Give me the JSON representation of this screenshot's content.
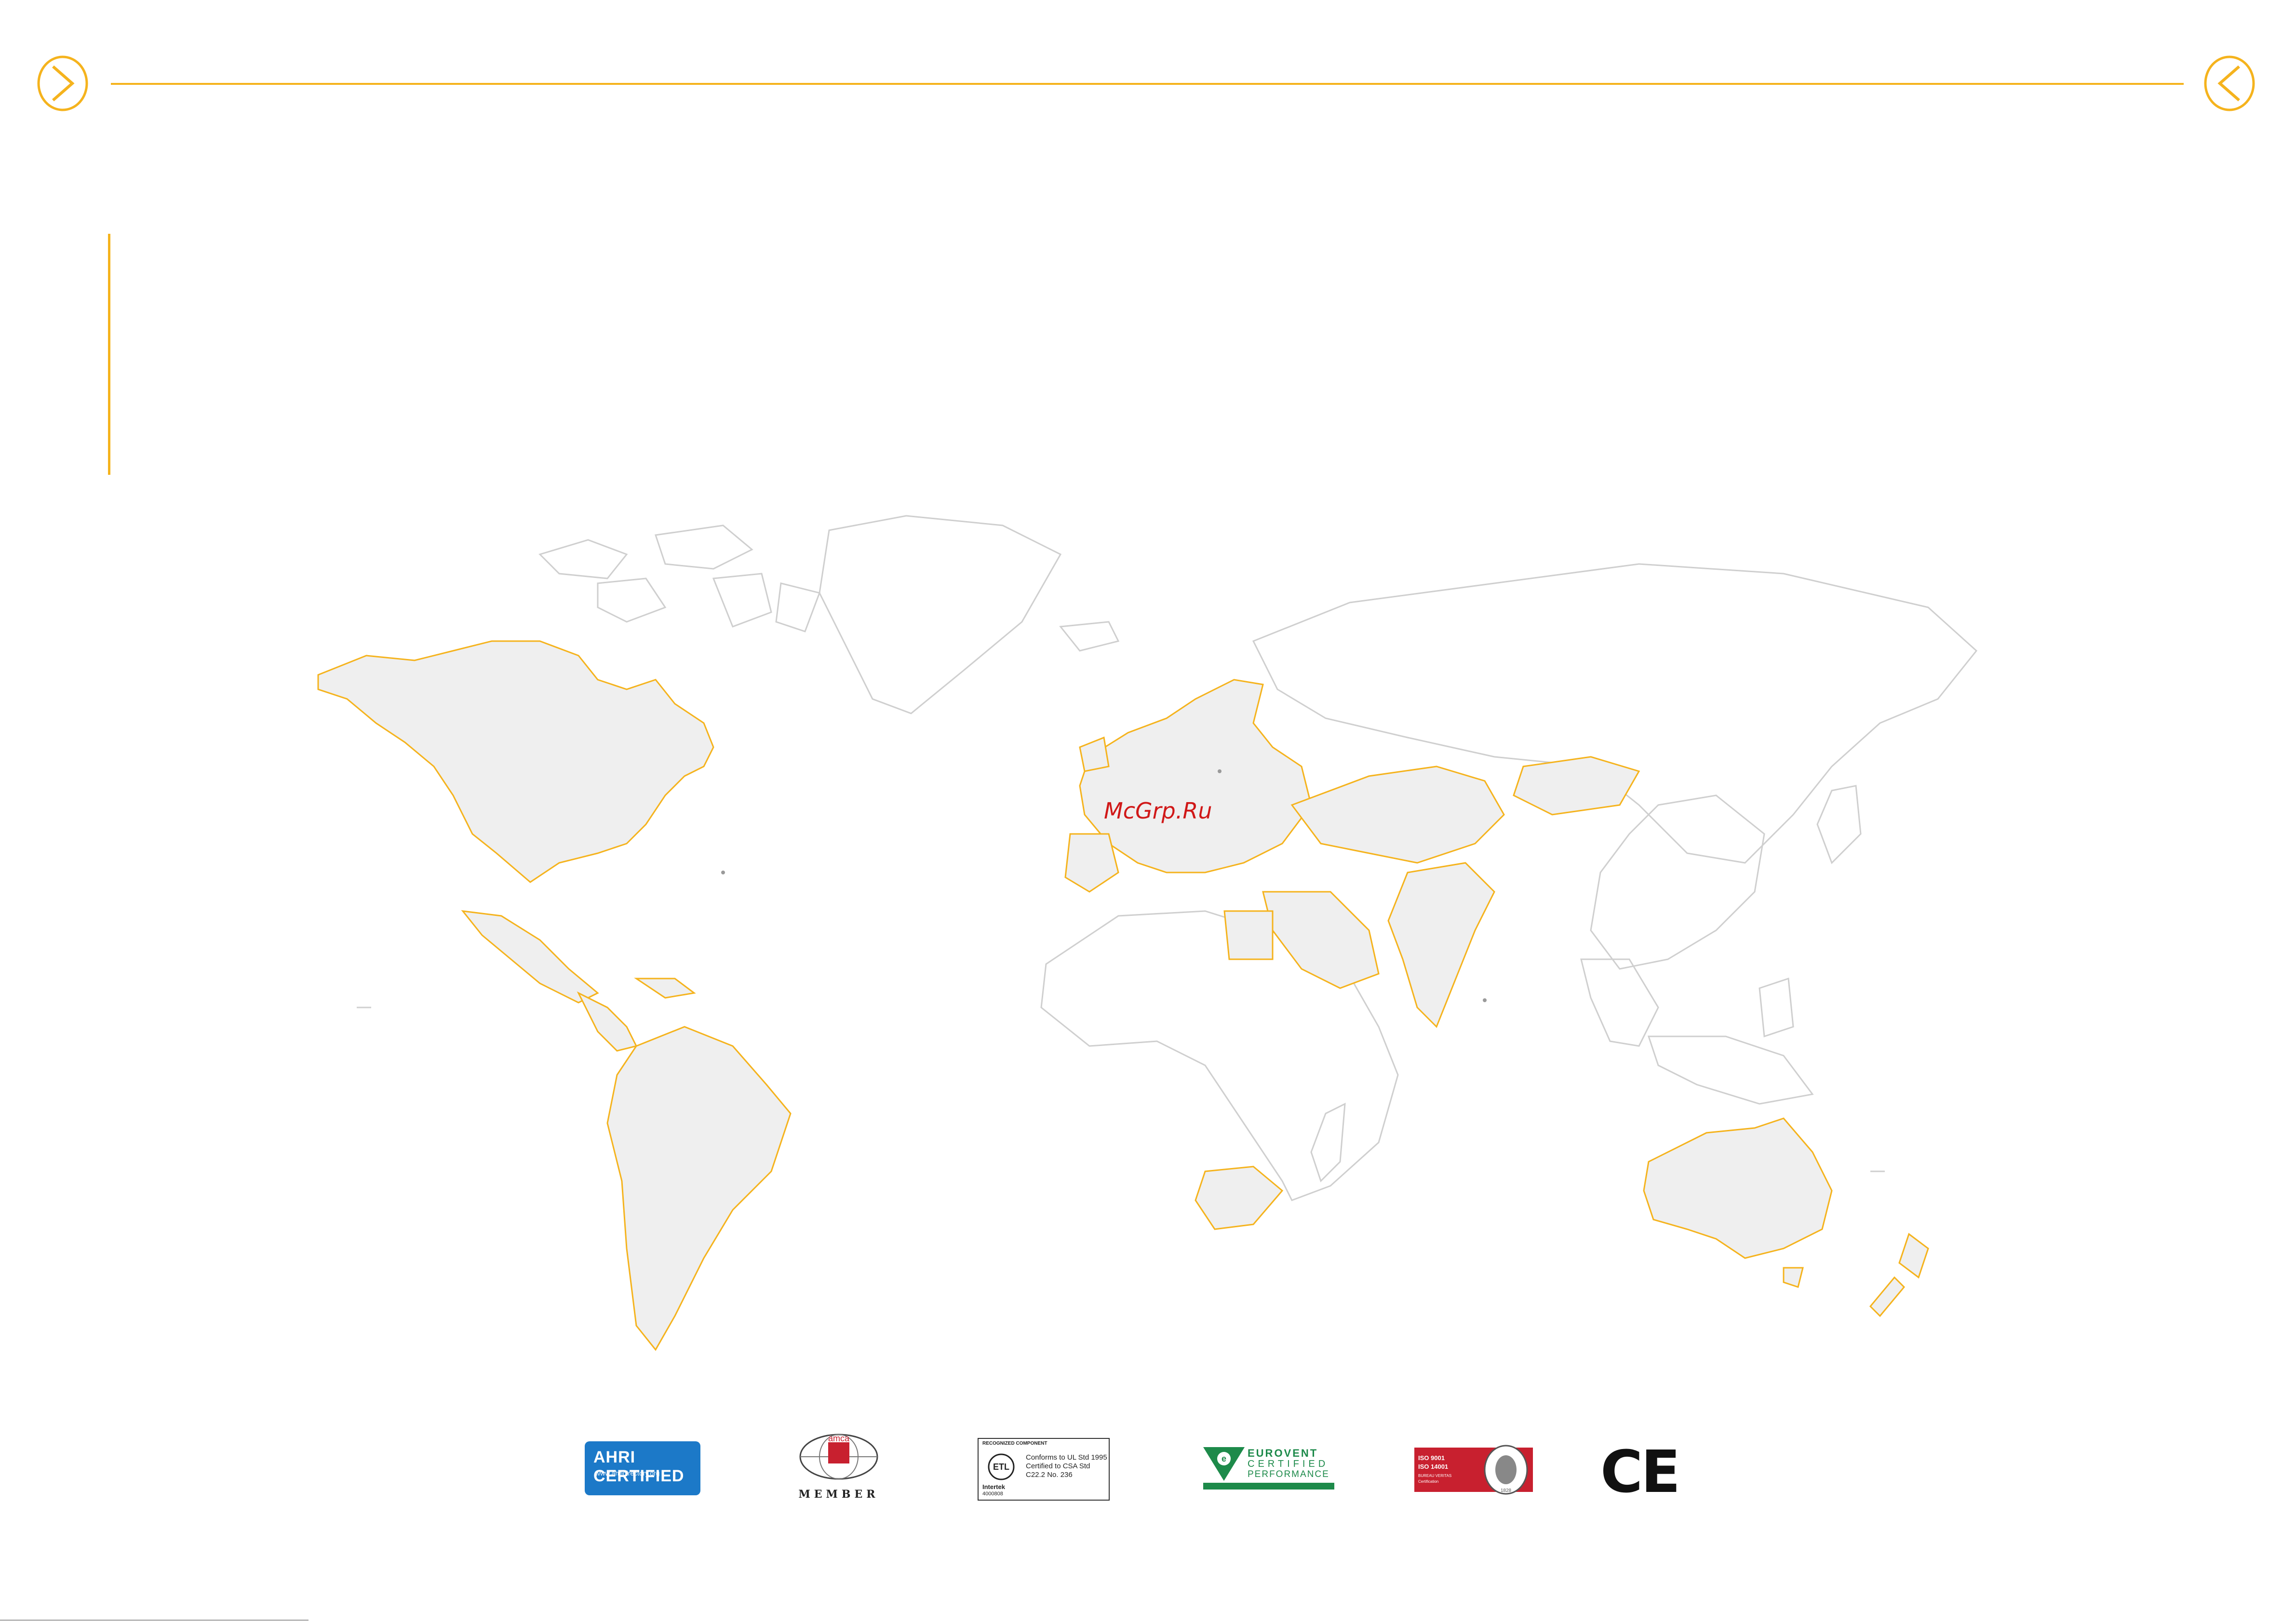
{
  "colors": {
    "accent": "#f5b31d",
    "land_fill": "#efefef",
    "border_grey": "#cfcfcf",
    "ahri_blue": "#1c79c8",
    "eurovent_green": "#1d8a4a",
    "iso_red": "#c8202f",
    "watermark_red": "#d01818"
  },
  "nav": {
    "prev_icon": "chevron-left-icon",
    "next_icon": "chevron-right-icon"
  },
  "watermark": "McGrp.Ru",
  "certifications": {
    "ahri": {
      "label": "AHRI CERTIFIED",
      "sub": "www.ahridirectory.org",
      "icon": "ahri-logo"
    },
    "amca": {
      "label": "MEMBER",
      "mark": "amca",
      "icon": "amca-logo"
    },
    "etl": {
      "top_text": "RECOGNIZED COMPONENT",
      "lines": [
        "Conforms to UL Std 1995",
        "Certified to CSA Std",
        "C22.2 No. 236"
      ],
      "brand": "Intertek",
      "code": "4000808",
      "icon": "etl-logo"
    },
    "eurovent": {
      "line1": "EUROVENT",
      "line2": "CERTIFIED",
      "line3": "PERFORMANCE",
      "icon": "eurovent-logo"
    },
    "iso": {
      "line1": "ISO 9001",
      "line2": "ISO 14001",
      "line3": "BUREAU VERITAS",
      "line4": "Certification",
      "year": "1828",
      "icon": "bureau-veritas-logo"
    },
    "ce": {
      "label": "CE",
      "icon": "ce-mark"
    }
  }
}
